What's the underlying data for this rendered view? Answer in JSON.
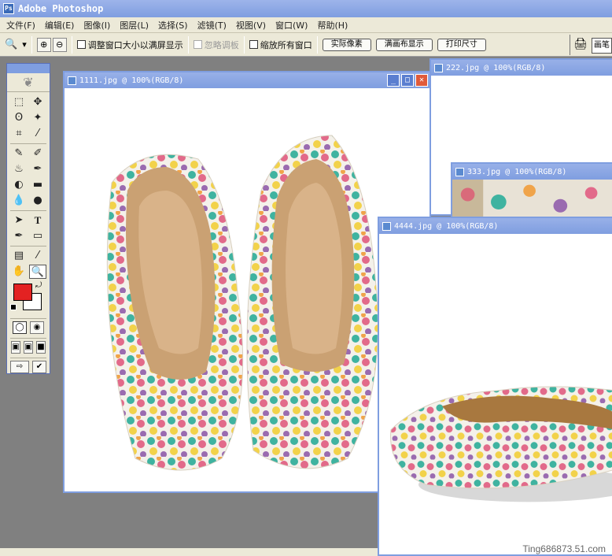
{
  "app": {
    "title": "Adobe Photoshop"
  },
  "menu": [
    "文件(F)",
    "编辑(E)",
    "图像(I)",
    "图层(L)",
    "选择(S)",
    "滤镜(T)",
    "视图(V)",
    "窗口(W)",
    "帮助(H)"
  ],
  "options": {
    "tool_glyph": "🔍",
    "dropdown": "▾",
    "zoom_in": "⊕",
    "zoom_out": "⊖",
    "resize_window_label": "调整窗口大小以满屏显示",
    "ignore_palettes_label": "忽略调板",
    "zoom_all_label": "缩放所有窗口",
    "actual_pixels": "实际像素",
    "fit_on_screen": "满画布显示",
    "print_size": "打印尺寸",
    "dock_tab": "画笔"
  },
  "toolbox": {
    "tools": [
      "⬚",
      "✥",
      "ʘ",
      "✦",
      "⌗",
      "⁄",
      "✎",
      "✐",
      "♨",
      "✒",
      "◐",
      "▬",
      "💧",
      "●",
      "➤",
      "T",
      "✒",
      "▭",
      "▤",
      "⁄",
      "✋",
      "🔍"
    ],
    "swap": "⤾"
  },
  "documents": [
    {
      "title": "1111.jpg @ 100%(RGB/8)"
    },
    {
      "title": "222.jpg @ 100%(RGB/8)"
    },
    {
      "title": "333.jpg @ 100%(RGB/8)"
    },
    {
      "title": "4444.jpg @ 100%(RGB/8)"
    }
  ],
  "window_buttons": {
    "min": "_",
    "max": "□",
    "close": "✕"
  },
  "watermark": "Ting686873.51.com",
  "colors": {
    "foreground": "#e32222",
    "background": "#ffffff",
    "accent": "#7f9ee0"
  }
}
